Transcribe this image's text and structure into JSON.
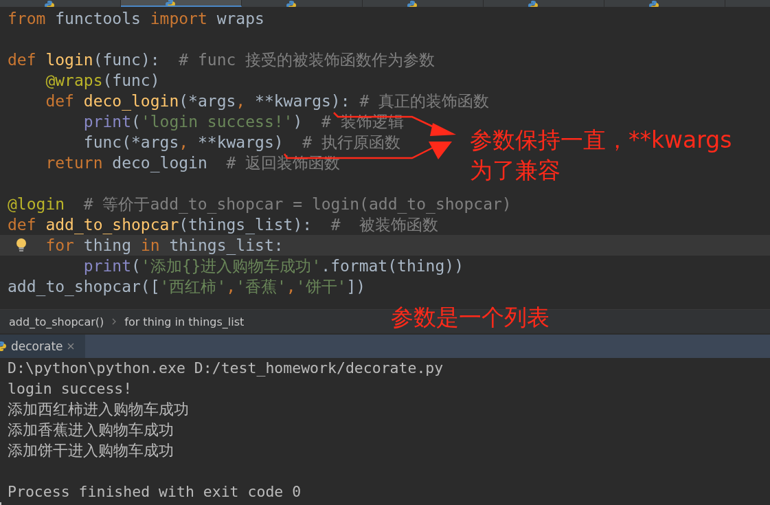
{
  "file_tabs": [
    {
      "selected": false
    },
    {
      "selected": true
    },
    {
      "selected": false
    },
    {
      "selected": false
    },
    {
      "selected": false
    },
    {
      "selected": false
    }
  ],
  "code": [
    {
      "current": false,
      "bulb": false,
      "tokens": [
        {
          "kind": "keyword",
          "text": "from"
        },
        {
          "kind": "plain",
          "text": " functools "
        },
        {
          "kind": "keyword",
          "text": "import"
        },
        {
          "kind": "plain",
          "text": " wraps"
        }
      ]
    },
    {
      "current": false,
      "bulb": false
    },
    {
      "current": false,
      "bulb": false,
      "tokens": [
        {
          "kind": "keyword",
          "text": "def "
        },
        {
          "kind": "function",
          "text": "login"
        },
        {
          "kind": "plain",
          "text": "(func):  "
        },
        {
          "kind": "comment",
          "text": "# func 接受的被装饰函数作为参数"
        }
      ]
    },
    {
      "current": false,
      "bulb": false,
      "tokens": [
        {
          "kind": "decorator",
          "text": "    @wraps"
        },
        {
          "kind": "plain",
          "text": "(func)"
        }
      ]
    },
    {
      "current": false,
      "bulb": false,
      "tokens": [
        {
          "kind": "keyword",
          "text": "    def "
        },
        {
          "kind": "function",
          "text": "deco_login"
        },
        {
          "kind": "plain",
          "text": "(*args"
        },
        {
          "kind": "keyword",
          "text": ", "
        },
        {
          "kind": "plain",
          "text": "**kwargs): "
        },
        {
          "kind": "comment",
          "text": "# 真正的装饰函数"
        }
      ]
    },
    {
      "current": false,
      "bulb": false,
      "tokens": [
        {
          "kind": "builtin",
          "text": "        print"
        },
        {
          "kind": "plain",
          "text": "("
        },
        {
          "kind": "string",
          "text": "'login success!'"
        },
        {
          "kind": "plain",
          "text": ")  "
        },
        {
          "kind": "comment",
          "text": "# 装饰逻辑"
        }
      ]
    },
    {
      "current": false,
      "bulb": false,
      "tokens": [
        {
          "kind": "plain",
          "text": "        func(*args"
        },
        {
          "kind": "keyword",
          "text": ", "
        },
        {
          "kind": "plain",
          "text": "**kwargs)  "
        },
        {
          "kind": "comment",
          "text": "# 执行原函数"
        }
      ]
    },
    {
      "current": false,
      "bulb": false,
      "tokens": [
        {
          "kind": "keyword",
          "text": "    return "
        },
        {
          "kind": "plain",
          "text": "deco_login  "
        },
        {
          "kind": "comment",
          "text": "# 返回装饰函数"
        }
      ]
    },
    {
      "current": false,
      "bulb": false
    },
    {
      "current": false,
      "bulb": false,
      "tokens": [
        {
          "kind": "decorator",
          "text": "@login  "
        },
        {
          "kind": "comment",
          "text": "# 等价于add_to_shopcar = login(add_to_shopcar)"
        }
      ]
    },
    {
      "current": false,
      "bulb": false,
      "tokens": [
        {
          "kind": "keyword",
          "text": "def "
        },
        {
          "kind": "function",
          "text": "add_to_shopcar"
        },
        {
          "kind": "plain",
          "text": "(things_list):  "
        },
        {
          "kind": "comment",
          "text": "#  被装饰函数"
        }
      ]
    },
    {
      "current": true,
      "bulb": true,
      "tokens": [
        {
          "kind": "keyword",
          "text": "    for "
        },
        {
          "kind": "plain",
          "text": "thing "
        },
        {
          "kind": "keyword",
          "text": "in "
        },
        {
          "kind": "plain",
          "text": "things_list:"
        }
      ]
    },
    {
      "current": false,
      "bulb": false,
      "tokens": [
        {
          "kind": "builtin",
          "text": "        print"
        },
        {
          "kind": "plain",
          "text": "("
        },
        {
          "kind": "string",
          "text": "'添加{}进入购物车成功'"
        },
        {
          "kind": "plain",
          "text": ".format(thing))"
        }
      ]
    },
    {
      "current": false,
      "bulb": false,
      "tokens": [
        {
          "kind": "plain",
          "text": "add_to_shopcar(["
        },
        {
          "kind": "string",
          "text": "'西红柿'"
        },
        {
          "kind": "keyword",
          "text": ","
        },
        {
          "kind": "string",
          "text": "'香蕉'"
        },
        {
          "kind": "keyword",
          "text": ","
        },
        {
          "kind": "string",
          "text": "'饼干'"
        },
        {
          "kind": "plain",
          "text": "])"
        }
      ]
    }
  ],
  "annotations": [
    {
      "text": "参数保持一直，**kwargs为了兼容"
    },
    {
      "text": "参数是一个列表"
    }
  ],
  "breadcrumbs": [
    "add_to_shopcar()",
    "for thing in things_list"
  ],
  "run_tab": {
    "label": "decorate",
    "selected": true
  },
  "console": [
    "D:\\python\\python.exe D:/test_homework/decorate.py",
    "login success!",
    "添加西红柿进入购物车成功",
    "添加香蕉进入购物车成功",
    "添加饼干进入购物车成功"
  ],
  "exit_message": "Process finished with exit code 0"
}
